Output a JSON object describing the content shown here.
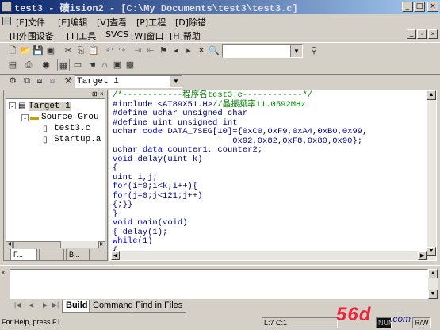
{
  "window": {
    "title": "test3  - 礦ision2 - [C:\\My Documents\\test3\\test3.c]",
    "buttons": {
      "minimize": "_",
      "maximize": "□",
      "close": "×"
    }
  },
  "menu": {
    "row1": [
      "[F]文件",
      "[E]编辑",
      "[V]查看",
      "[P]工程",
      "[D]除错"
    ],
    "row2": [
      "[I]外围设备",
      "[T]工具",
      "SVCS",
      "[W]窗口",
      "[H]帮助"
    ],
    "mdi_buttons": {
      "minimize": "_",
      "restore": "▫",
      "close": "×"
    }
  },
  "toolbar": {
    "find_value": "",
    "target_select": "Target 1"
  },
  "project_tree": {
    "target": "Target 1",
    "group": "Source Grou",
    "files": [
      "test3.c",
      "Startup.a"
    ],
    "tabs": [
      "F...",
      "",
      "B..."
    ]
  },
  "editor": {
    "lines": [
      [
        {
          "t": "/*",
          "c": "cm"
        },
        {
          "t": "------------程序名test3.c------------",
          "c": "cm"
        },
        {
          "t": "*/",
          "c": "cm"
        }
      ],
      [
        {
          "t": "#include <AT89X51.H>",
          "c": "pl"
        },
        {
          "t": "//晶振频率11.0592MHz",
          "c": "cm"
        }
      ],
      [
        {
          "t": "#define uchar unsigned char",
          "c": "pl"
        }
      ],
      [
        {
          "t": "#define uint unsigned int",
          "c": "pl"
        }
      ],
      [
        {
          "t": "uchar ",
          "c": "pl"
        },
        {
          "t": "code",
          "c": "kw"
        },
        {
          "t": " DATA_7SEG[10]={0xC0,0xF9,0xA4,0xB0,0x99,",
          "c": "pl"
        }
      ],
      [
        {
          "t": "                        0x92,0x82,0xF8,0x80,0x90};",
          "c": "pl"
        }
      ],
      [
        {
          "t": "uchar ",
          "c": "pl"
        },
        {
          "t": "data",
          "c": "kw"
        },
        {
          "t": " counter1, counter2;",
          "c": "pl"
        }
      ],
      [
        {
          "t": "void",
          "c": "kw"
        },
        {
          "t": " delay(uint k)",
          "c": "pl"
        }
      ],
      [
        {
          "t": "{",
          "c": "pl"
        }
      ],
      [
        {
          "t": "uint i,j;",
          "c": "pl"
        }
      ],
      [
        {
          "t": "for",
          "c": "kw"
        },
        {
          "t": "(i=0;i<k;i++){",
          "c": "pl"
        }
      ],
      [
        {
          "t": "for",
          "c": "kw"
        },
        {
          "t": "(j=0;j<121;j++)",
          "c": "pl"
        }
      ],
      [
        {
          "t": "{;}}",
          "c": "pl"
        }
      ],
      [
        {
          "t": "}",
          "c": "pl"
        }
      ],
      [
        {
          "t": "void",
          "c": "kw"
        },
        {
          "t": " main(void)",
          "c": "pl"
        }
      ],
      [
        {
          "t": "{ delay(1);",
          "c": "pl"
        }
      ],
      [
        {
          "t": "while",
          "c": "kw"
        },
        {
          "t": "(1)",
          "c": "pl"
        }
      ],
      [
        {
          "t": "{",
          "c": "pl"
        }
      ]
    ]
  },
  "output": {
    "tabs": [
      "Build",
      "Command",
      "Find in Files"
    ]
  },
  "status": {
    "help": "For Help, press F1",
    "position": "L:7 C:1",
    "num": "NUM",
    "rw": "R/W"
  },
  "watermark": {
    "logo": "56d",
    "suffix": ".com"
  },
  "colors": {
    "title_start": "#0a246a",
    "title_end": "#a6caf0",
    "keyword": "#0000ff",
    "comment": "#008000",
    "plain": "#000080"
  }
}
